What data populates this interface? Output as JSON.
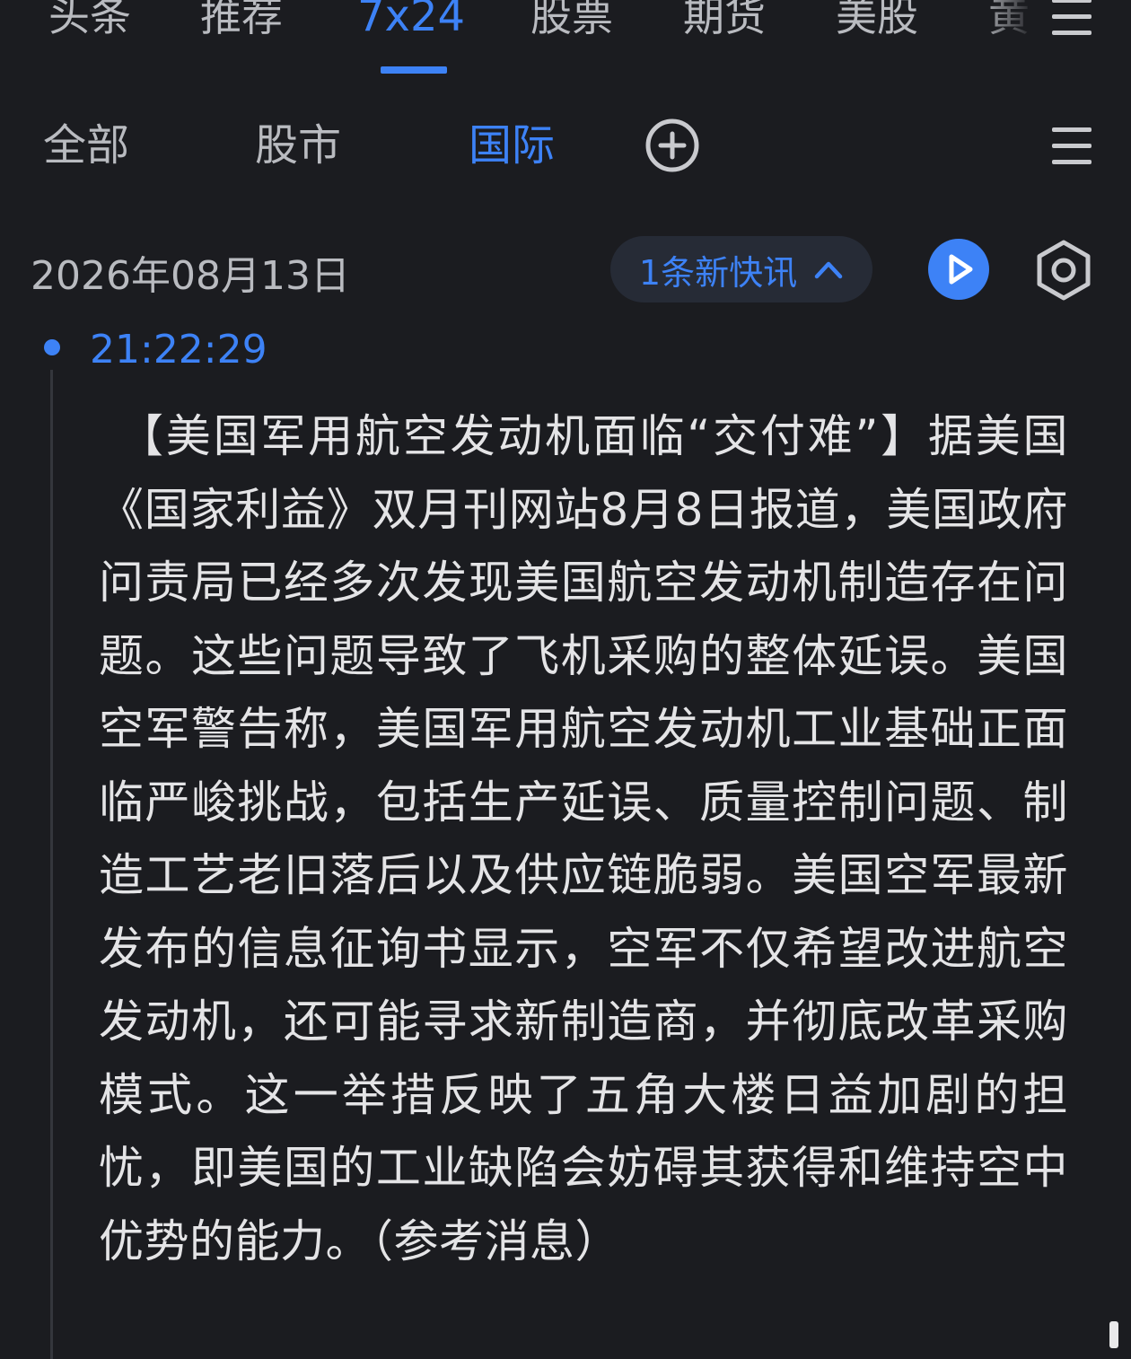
{
  "top_tabs": [
    "头条",
    "推荐",
    "7x24",
    "股票",
    "期货",
    "美股",
    "黄"
  ],
  "top_tabs_active": "7x24",
  "sub_tabs": [
    "全部",
    "股市",
    "国际"
  ],
  "sub_tabs_active": "国际",
  "date": "2026年08月13日",
  "new_flash_label": "1条新快讯",
  "news": {
    "time": "21:22:29",
    "body": "【美国军用航空发动机面临“交付难”】据美国《国家利益》双月刊网站8月8日报道，美国政府问责局已经多次发现美国航空发动机制造存在问题。这些问题导致了飞机采购的整体延误。美国空军警告称，美国军用航空发动机工业基础正面临严峻挑战，包括生产延误、质量控制问题、制造工艺老旧落后以及供应链脆弱。美国空军最新发布的信息征询书显示，空军不仅希望改进航空发动机，还可能寻求新制造商，并彻底改革采购模式。这一举措反映了五角大楼日益加剧的担忧，即美国的工业缺陷会妨碍其获得和维持空中优势的能力。（参考消息）"
  },
  "colors": {
    "background": "#1b1c20",
    "accent": "#3d82f6",
    "text_primary": "#e4e4e6",
    "text_secondary": "#b9bbc0",
    "pill_background": "#262b36"
  },
  "icons": [
    "menu-icon",
    "add-circle-icon",
    "chevron-up-icon",
    "play-icon",
    "settings-icon"
  ]
}
